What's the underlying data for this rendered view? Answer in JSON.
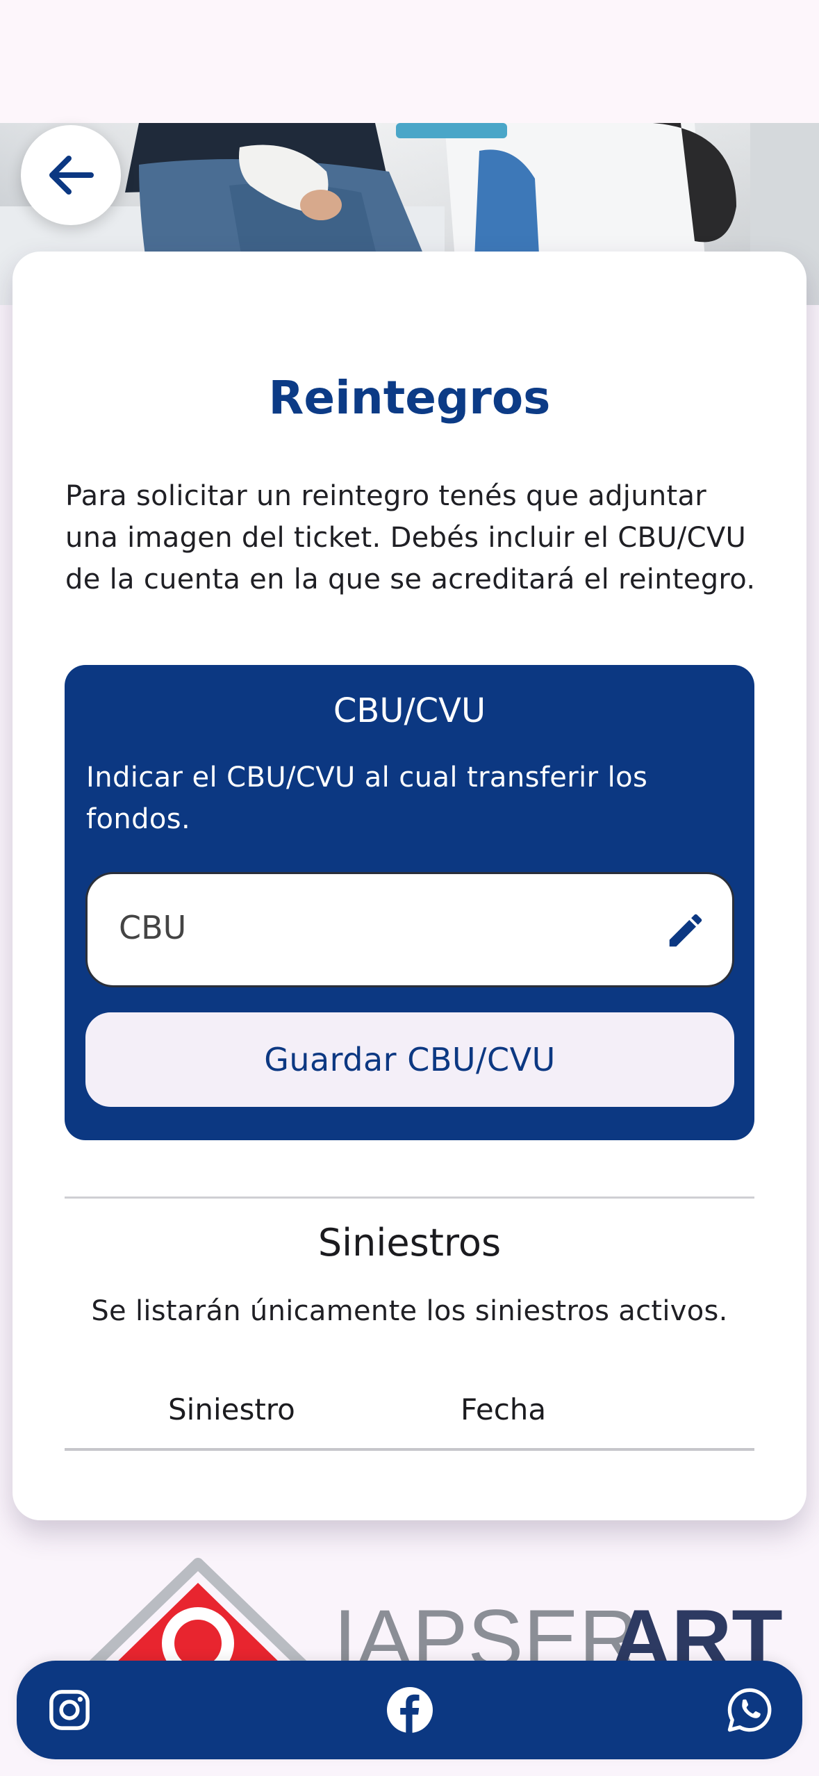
{
  "header": {
    "back_icon": "arrow-left-icon"
  },
  "hero": {
    "image": "patient-with-bandaged-wrist-and-doctor"
  },
  "card": {
    "title": "Reintegros",
    "intro": "Para solicitar un reintegro tenés que adjuntar una imagen del ticket. Debés incluir el CBU/CVU de la cuenta en la que se acreditará el reintegro."
  },
  "cbu": {
    "title": "CBU/CVU",
    "description": "Indicar el CBU/CVU al cual transferir los fondos.",
    "input_placeholder": "CBU",
    "input_value": "",
    "edit_icon": "pencil-icon",
    "save_label": "Guardar CBU/CVU"
  },
  "siniestros": {
    "title": "Siniestros",
    "description": "Se listarán únicamente los siniestros activos.",
    "columns": [
      "Siniestro",
      "Fecha"
    ],
    "rows": []
  },
  "footer": {
    "logo_text_light": "IAPSER",
    "logo_text_bold": "ART",
    "social": [
      "instagram-icon",
      "facebook-icon",
      "whatsapp-icon"
    ]
  },
  "colors": {
    "primary": "#0C3882",
    "title": "#0C3B86",
    "button_bg": "#F4EFF8",
    "page_bg": "#FAF4FB"
  }
}
